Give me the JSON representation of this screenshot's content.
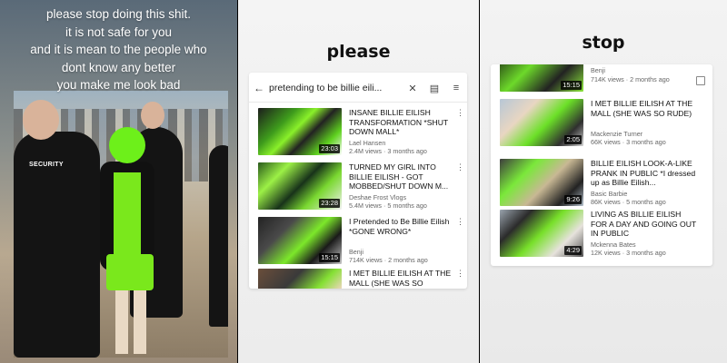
{
  "panel1": {
    "text_lines": [
      "please stop doing this shit.",
      "it is not safe for you",
      "and it is mean to the people who",
      "dont know any better",
      "you make me look bad"
    ],
    "photo_label": "SECURITY"
  },
  "panel2": {
    "heading": "please",
    "search": {
      "query": "pretending to be billie eili...",
      "back_icon": "arrow-left-icon",
      "clear_icon": "close-icon",
      "cast_icon": "cast-icon",
      "filter_icon": "filter-icon"
    },
    "results": [
      {
        "title": "INSANE BILLIE EILISH TRANSFORMATION *SHUT DOWN MALL*",
        "channel": "Lael Hansen",
        "meta": "2.4M views · 3 months ago",
        "duration": "23:03"
      },
      {
        "title": "TURNED MY GIRL INTO BILLIE EILISH - GOT MOBBED/SHUT DOWN M...",
        "channel": "Deshae Frost Vlogs",
        "meta": "5.4M views · 5 months ago",
        "duration": "23:28"
      },
      {
        "title": "I Pretended to Be Billie Eilish *GONE WRONG*",
        "channel": "Benji",
        "meta": "714K views · 2 months ago",
        "duration": "15:15"
      },
      {
        "title": "I MET BILLIE EILISH AT THE MALL (SHE WAS SO",
        "channel": "",
        "meta": "",
        "duration": ""
      }
    ]
  },
  "panel3": {
    "heading": "stop",
    "partial_top": {
      "channel": "Benji",
      "meta": "714K views · 2 months ago",
      "duration": "15:15"
    },
    "results": [
      {
        "title": "I MET BILLIE EILISH AT THE MALL (SHE WAS SO RUDE)",
        "channel": "Mackenzie Turner",
        "meta": "66K views · 3 months ago",
        "duration": "2:05"
      },
      {
        "title": "BILLIE EILISH LOOK-A-LIKE PRANK IN PUBLIC *I dressed up as Billie Eilish...",
        "channel": "Basic Barbie",
        "meta": "86K views · 5 months ago",
        "duration": "9:26"
      },
      {
        "title": "LIVING AS BILLIE EILISH FOR A DAY AND GOING OUT IN PUBLIC",
        "channel": "Mckenna Bates",
        "meta": "12K views · 3 months ago",
        "duration": "4:29"
      }
    ]
  },
  "colors": {
    "accent_green": "#7ae81c",
    "panel_bg": "#f2f2f2",
    "text": "#111111"
  }
}
